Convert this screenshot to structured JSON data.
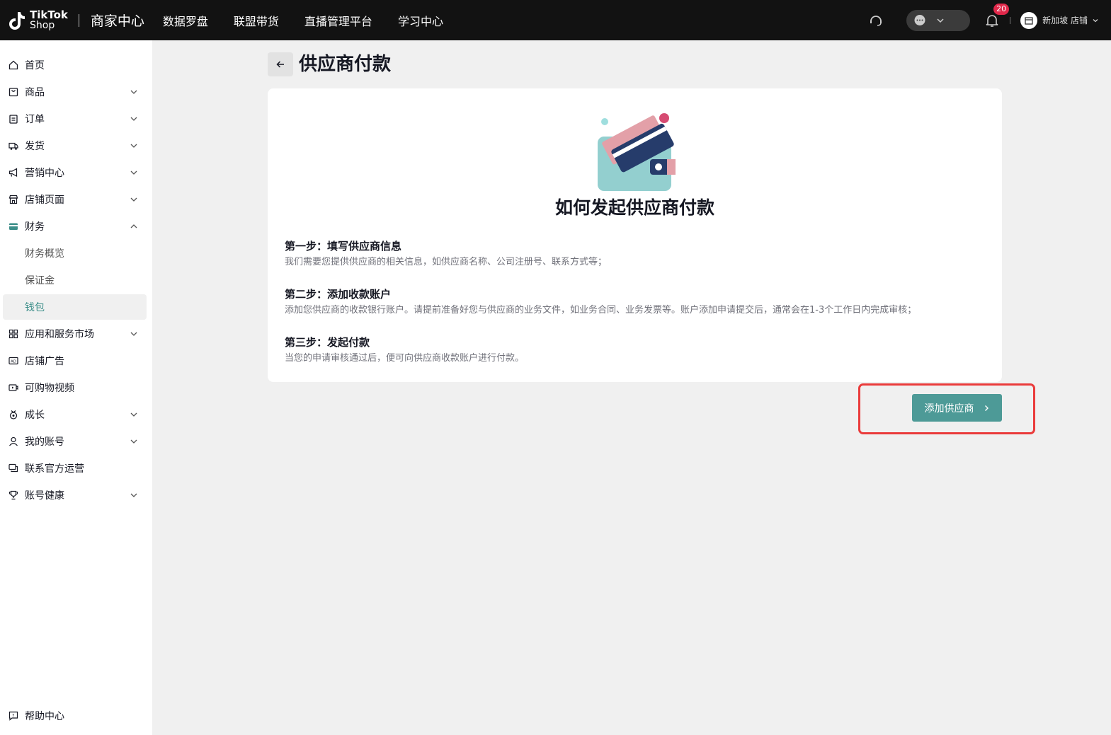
{
  "topbar": {
    "logo_line1": "TikTok",
    "logo_line2": "Shop",
    "title": "商家中心",
    "nav": [
      "数据罗盘",
      "联盟带货",
      "直播管理平台",
      "学习中心"
    ],
    "notification_count": "20",
    "store_name": "新加坡 店铺"
  },
  "sidebar": {
    "items": [
      {
        "label": "首页",
        "icon": "home-icon"
      },
      {
        "label": "商品",
        "icon": "product-icon"
      },
      {
        "label": "订单",
        "icon": "order-icon"
      },
      {
        "label": "发货",
        "icon": "truck-icon"
      },
      {
        "label": "营销中心",
        "icon": "megaphone-icon"
      },
      {
        "label": "店铺页面",
        "icon": "store-icon"
      },
      {
        "label": "财务",
        "icon": "wallet-icon"
      },
      {
        "label": "财务概览"
      },
      {
        "label": "保证金"
      },
      {
        "label": "钱包"
      },
      {
        "label": "应用和服务市场",
        "icon": "apps-icon"
      },
      {
        "label": "店铺广告",
        "icon": "ad-icon"
      },
      {
        "label": "可购物视频",
        "icon": "video-icon"
      },
      {
        "label": "成长",
        "icon": "medal-icon"
      },
      {
        "label": "我的账号",
        "icon": "user-icon"
      },
      {
        "label": "联系官方运营",
        "icon": "chat-icon"
      },
      {
        "label": "账号健康",
        "icon": "trophy-icon"
      }
    ],
    "help": "帮助中心"
  },
  "main": {
    "title": "供应商付款",
    "card_title": "如何发起供应商付款",
    "steps": [
      {
        "title": "第一步：填写供应商信息",
        "desc": "我们需要您提供供应商的相关信息，如供应商名称、公司注册号、联系方式等；"
      },
      {
        "title": "第二步：添加收款账户",
        "desc": "添加您供应商的收款银行账户。请提前准备好您与供应商的业务文件，如业务合同、业务发票等。账户添加申请提交后，通常会在1-3个工作日内完成审核；"
      },
      {
        "title": "第三步：发起付款",
        "desc": "当您的申请审核通过后，便可向供应商收款账户进行付款。"
      }
    ],
    "add_button": "添加供应商"
  },
  "colors": {
    "topbar": "#121212",
    "accent": "#4d9a97",
    "active_text": "#3d8f8a",
    "highlight": "#ea3b3b"
  }
}
